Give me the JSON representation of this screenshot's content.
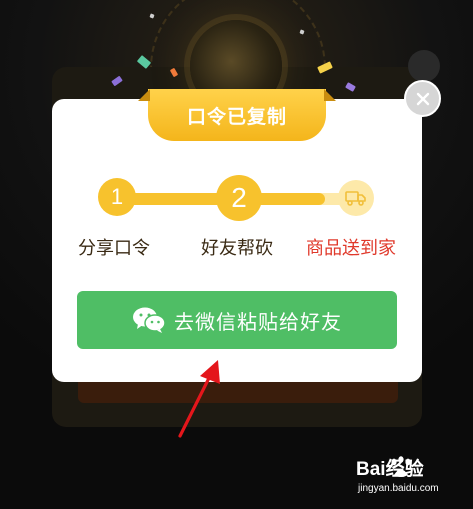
{
  "dialog": {
    "banner_title": "口令已复制",
    "close_icon": "close-icon",
    "steps": [
      {
        "number": "1",
        "label": "分享口令",
        "state": "done"
      },
      {
        "number": "2",
        "label": "好友帮砍",
        "state": "current"
      },
      {
        "icon": "truck-icon",
        "label": "商品送到家",
        "state": "pending"
      }
    ],
    "progress_fraction": 0.87,
    "cta": {
      "icon": "wechat-icon",
      "label": "去微信粘贴给好友"
    }
  },
  "annotation": {
    "icon": "red-arrow-icon"
  },
  "watermark": {
    "brand": "Bai经验",
    "url": "jingyan.baidu.com"
  },
  "colors": {
    "accent_yellow": "#f7c22d",
    "track_light": "#fde9a9",
    "cta_green": "#4fbe65",
    "highlight_red": "#e0392b"
  }
}
